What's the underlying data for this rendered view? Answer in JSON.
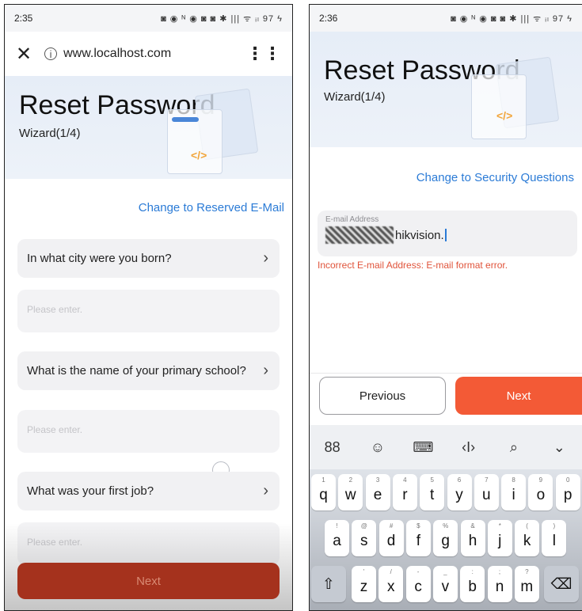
{
  "left": {
    "status": {
      "time": "2:35",
      "icons": "◙ ◉ ᴺ      ◉ ◙ ◙ ✱ ||| ᯤ ᵢₗ 97 ϟ"
    },
    "browser": {
      "close": "✕",
      "info": "i",
      "url": "www.localhost.com",
      "menu": "⋮⋮"
    },
    "header": {
      "title": "Reset Password",
      "subtitle": "Wizard(1/4)",
      "code_tag": "</>"
    },
    "switch_link": "Change to Reserved E-Mail",
    "questions": [
      {
        "text": "In what city were you born?",
        "placeholder": "Please enter."
      },
      {
        "text": "What is the name of your primary school?",
        "placeholder": "Please enter."
      },
      {
        "text": "What was your first job?",
        "placeholder": "Please enter."
      }
    ],
    "chevron": "›",
    "next_label": "Next"
  },
  "right": {
    "status": {
      "time": "2:36",
      "icons": "◙ ◉ ᴺ      ◉ ◙ ◙ ✱ ||| ᯤ ᵢₗ 97 ϟ"
    },
    "header": {
      "title": "Reset Password",
      "subtitle": "Wizard(1/4)",
      "code_tag": "</>"
    },
    "switch_link": "Change to Security Questions",
    "email": {
      "label": "E-mail Address",
      "visible_value": "hikvision."
    },
    "error": "Incorrect E-mail Address: E-mail format error.",
    "prev_label": "Previous",
    "next_label": "Next",
    "toolbar": [
      "88",
      "☺",
      "⌨",
      "‹I›",
      "⌕",
      "⌄"
    ],
    "keyboard": {
      "row1": [
        [
          "q",
          "1"
        ],
        [
          "w",
          "2"
        ],
        [
          "e",
          "3"
        ],
        [
          "r",
          "4"
        ],
        [
          "t",
          "5"
        ],
        [
          "y",
          "6"
        ],
        [
          "u",
          "7"
        ],
        [
          "i",
          "8"
        ],
        [
          "o",
          "9"
        ],
        [
          "p",
          "0"
        ]
      ],
      "row2": [
        [
          "a",
          "!"
        ],
        [
          "s",
          "@"
        ],
        [
          "d",
          "#"
        ],
        [
          "f",
          "$"
        ],
        [
          "g",
          "%"
        ],
        [
          "h",
          "&"
        ],
        [
          "j",
          "*"
        ],
        [
          "k",
          "("
        ],
        [
          "l",
          ")"
        ]
      ],
      "row3": [
        [
          "z",
          "'"
        ],
        [
          "x",
          "/"
        ],
        [
          "c",
          "-"
        ],
        [
          "v",
          "_"
        ],
        [
          "b",
          ":"
        ],
        [
          "n",
          ";"
        ],
        [
          "m",
          "?"
        ]
      ],
      "shift": "⇧",
      "backspace": "⌫"
    }
  }
}
